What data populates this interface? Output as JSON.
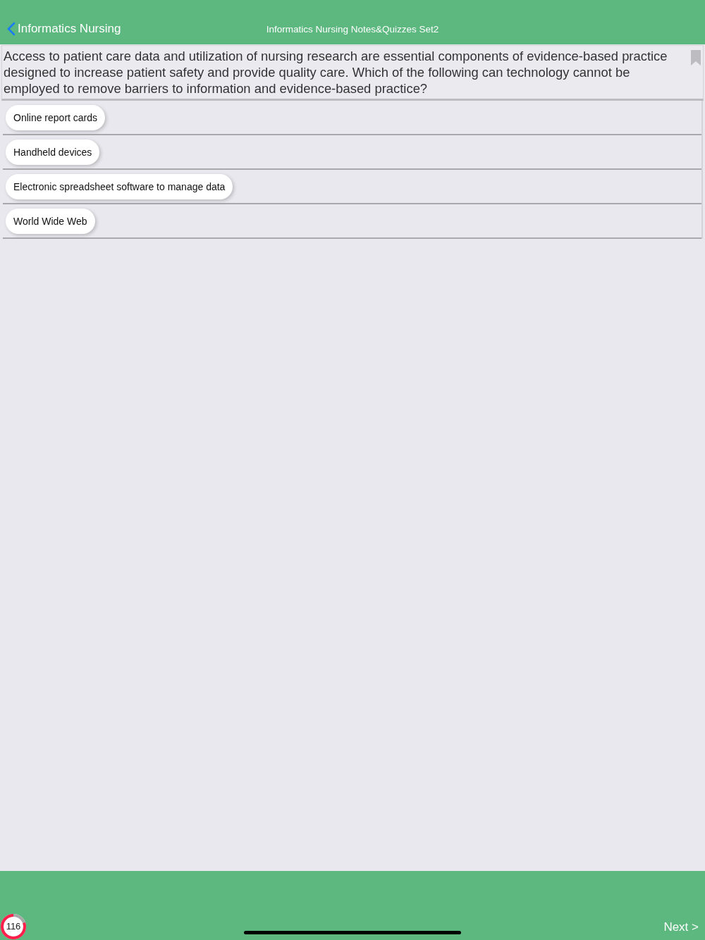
{
  "nav": {
    "back": "Informatics Nursing",
    "title": "Informatics Nursing Notes&Quizzes Set2"
  },
  "question": {
    "text": "Access to patient care data and utilization of nursing research are essential components of evidence-based practice designed to increase patient safety and provide quality care. Which of the following can technology cannot be employed to remove barriers to information and evidence-based practice?",
    "bookmarked": false
  },
  "options": [
    {
      "label": "Online report cards"
    },
    {
      "label": "Handheld devices"
    },
    {
      "label": "Electronic spreadsheet software to manage data"
    },
    {
      "label": "World Wide Web"
    }
  ],
  "footer": {
    "counter": "116",
    "next": "Next >"
  }
}
